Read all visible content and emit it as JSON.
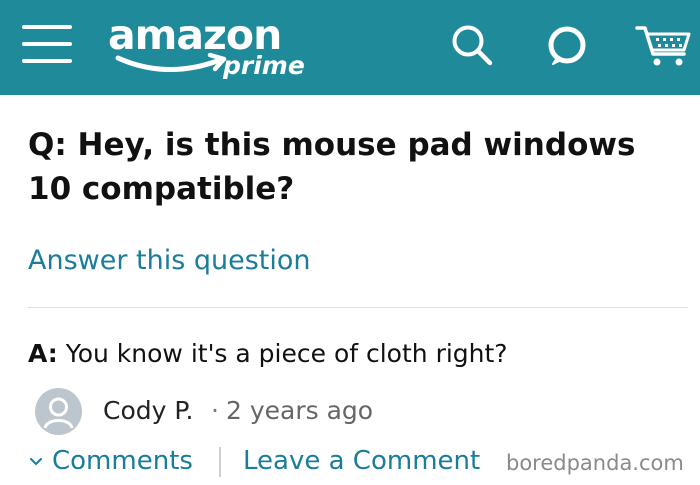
{
  "header": {
    "logo_text": "amazon",
    "logo_subtext": "prime",
    "icons": [
      "menu-icon",
      "search-icon",
      "alexa-icon",
      "cart-icon"
    ],
    "background_color": "#1f8a9a"
  },
  "question": {
    "text": "Q: Hey, is this mouse pad windows 10 compatible?",
    "answer_link_label": "Answer this question"
  },
  "answer": {
    "prefix": "A:",
    "text": "You know it's a piece of cloth right?",
    "author": "Cody P.",
    "separator": "·",
    "time": "2 years ago"
  },
  "actions": {
    "comments_label": "Comments",
    "leave_comment_label": "Leave a Comment"
  },
  "watermark": "boredpanda.com",
  "colors": {
    "link": "#1a7d9a",
    "header": "#1f8a9a",
    "avatar": "#bdc6cc"
  }
}
